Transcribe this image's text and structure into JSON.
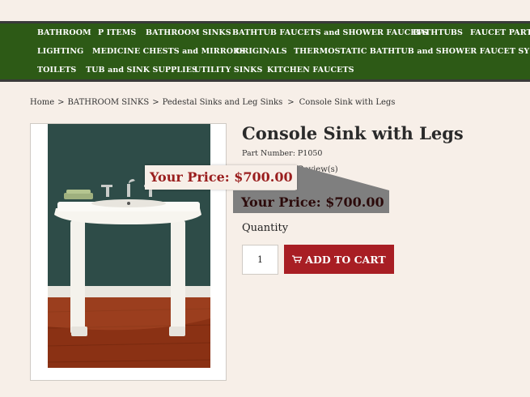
{
  "nav": {
    "items": [
      "BATHROOM",
      "P ITEMS",
      "BATHROOM SINKS",
      "BATHTUB FAUCETS and SHOWER FAUCETS",
      "BATHTUBS",
      "FAUCET PARTS",
      "LIGHTING",
      "MEDICINE CHESTS and MIRRORS",
      "ORIGINALS",
      "THERMOSTATIC BATHTUB and SHOWER FAUCET SYSTEM",
      "TOILETS",
      "TUB and SINK SUPPLIES",
      "UTILITY SINKS",
      "KITCHEN FAUCETS"
    ]
  },
  "breadcrumb": {
    "home": "Home",
    "sep1": ">",
    "c1": "BATHROOM SINKS",
    "sep2": ">",
    "c2": "Pedestal Sinks and Leg Sinks",
    "sep3": ">",
    "current": "Console Sink with Legs"
  },
  "product": {
    "title": "Console Sink with Legs",
    "part_number": "Part Number: P1050",
    "review_partial": "Review(s)",
    "price_popup": "Your Price:  $700.00",
    "price_shadow": "Your Price:  $700.00",
    "quantity_label": "Quantity",
    "quantity_value": "1",
    "add_to_cart": "ADD TO CART"
  },
  "colors": {
    "nav_bg": "#2d5a16",
    "page_bg": "#f7efe8",
    "price_red": "#9a1e1e",
    "button_red": "#a81e24"
  },
  "icons": [
    "cart-icon"
  ]
}
